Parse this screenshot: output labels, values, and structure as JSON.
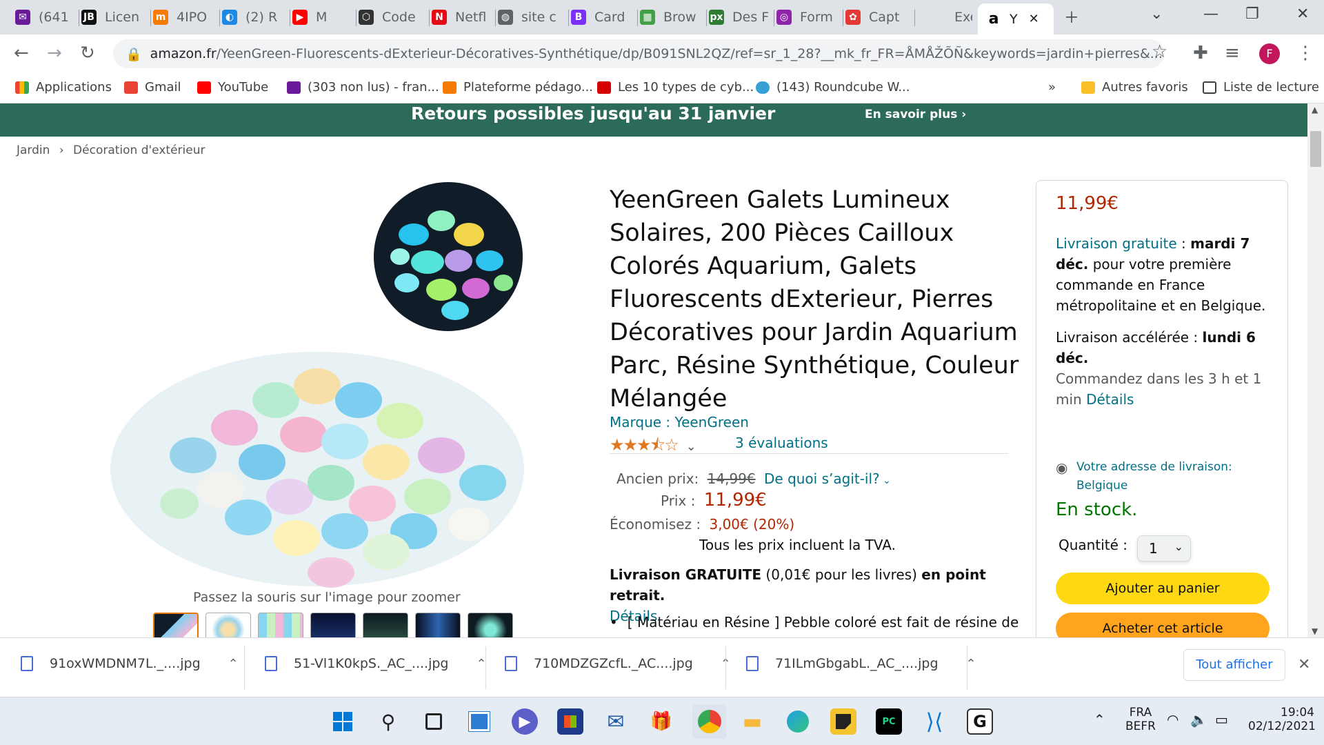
{
  "browser": {
    "tabs": [
      {
        "label": "(641",
        "color": "#6a1b9a",
        "glyph": "✉"
      },
      {
        "label": "Licen",
        "color": "#111111",
        "glyph": "JB"
      },
      {
        "label": "4IPO",
        "color": "#f57c00",
        "glyph": "m"
      },
      {
        "label": "(2) R",
        "color": "#1e88e5",
        "glyph": "◐"
      },
      {
        "label": "M",
        "color": "#ff0000",
        "glyph": "▶"
      },
      {
        "label": "Code",
        "color": "#333333",
        "glyph": "⬡"
      },
      {
        "label": "Netfl",
        "color": "#e50914",
        "glyph": "N"
      },
      {
        "label": "site c",
        "color": "#5f6368",
        "glyph": "◍"
      },
      {
        "label": "Card",
        "color": "#7b2ff7",
        "glyph": "B"
      },
      {
        "label": "Brow",
        "color": "#43a047",
        "glyph": "▦"
      },
      {
        "label": "Des F",
        "color": "#2e7d32",
        "glyph": "px"
      },
      {
        "label": "Form",
        "color": "#8e24aa",
        "glyph": "◎"
      },
      {
        "label": "Capt",
        "color": "#e53935",
        "glyph": "✿"
      },
      {
        "label": "Exerc",
        "color": "#dfe3e8",
        "glyph": ""
      },
      {
        "label": "Y",
        "color": "#ffffff",
        "glyph": "a"
      }
    ],
    "url_host": "amazon.fr",
    "url_path": "/YeenGreen-Fluorescents-dExterieur-Décoratives-Synthétique/dp/B091SNL2QZ/ref=sr_1_28?__mk_fr_FR=ÅMÅŽÕÑ&keywords=jardin+pierres&...",
    "profile_initial": "F",
    "bookmarks": [
      "Applications",
      "Gmail",
      "YouTube",
      "(303 non lus) - fran...",
      "Plateforme pédago...",
      "Les 10 types de cyb...",
      "(143) Roundcube W..."
    ],
    "bookmarks_more": "»",
    "other_bookmarks": "Autres favoris",
    "reading_list": "Liste de lecture"
  },
  "banner": {
    "text": "Retours possibles jusqu'au 31 janvier",
    "link": "En savoir plus ›"
  },
  "breadcrumb": {
    "level1": "Jardin",
    "sep": "›",
    "level2": "Décoration d'extérieur"
  },
  "gallery": {
    "hint": "Passez la souris sur l'image pour zoomer"
  },
  "product": {
    "title": "YeenGreen Galets Lumineux Solaires, 200 Pièces Cailloux Colorés Aquarium, Galets Fluorescents dExterieur, Pierres Décoratives pour Jardin Aquarium Parc, Résine Synthétique, Couleur Mélangée",
    "brand": "Marque : YeenGreen",
    "rating": 3.5,
    "ratings_count": "3 évaluations",
    "old_price_label": "Ancien prix:",
    "old_price": "14,99€",
    "whats_this": "De quoi s’agit-il?",
    "price_label": "Prix :",
    "price": "11,99€",
    "save_label": "Économisez :",
    "save_value": "3,00€ (20%)",
    "vat_note": "Tous les prix incluent la TVA.",
    "delivery_bold1": "Livraison GRATUITE",
    "delivery_mid": " (0,01€ pour les livres) ",
    "delivery_bold2": "en point retrait.",
    "delivery_details": "Détails",
    "bullet1": "[ Matériau en Résine ] Pebble coloré est fait de résine de"
  },
  "buybox": {
    "price": "11,99€",
    "free_delivery_link": "Livraison gratuite",
    "free_delivery_sep": " : ",
    "free_delivery_date": "mardi 7 déc.",
    "free_delivery_note": "pour votre première commande en France métropolitaine et en Belgique.",
    "fast_label": "Livraison accélérée",
    "fast_sep": " : ",
    "fast_date": "lundi 6 déc.",
    "order_within": "Commandez dans les 3 h et 1 min",
    "details": "Détails",
    "address": "Votre adresse de livraison: Belgique",
    "stock": "En stock.",
    "qty_label": "Quantité :",
    "qty_value": "1",
    "add_to_cart": "Ajouter au panier",
    "buy_now": "Acheter cet article"
  },
  "downloads": {
    "files": [
      "91oxWMDNM7L._....jpg",
      "51-Vl1K0kpS._AC_....jpg",
      "710MDZGZcfL._AC....jpg",
      "71ILmGbgabL._AC_....jpg"
    ],
    "show_all": "Tout afficher"
  },
  "taskbar": {
    "lang1": "FRA",
    "lang2": "BEFR",
    "time": "19:04",
    "date": "02/12/2021"
  }
}
